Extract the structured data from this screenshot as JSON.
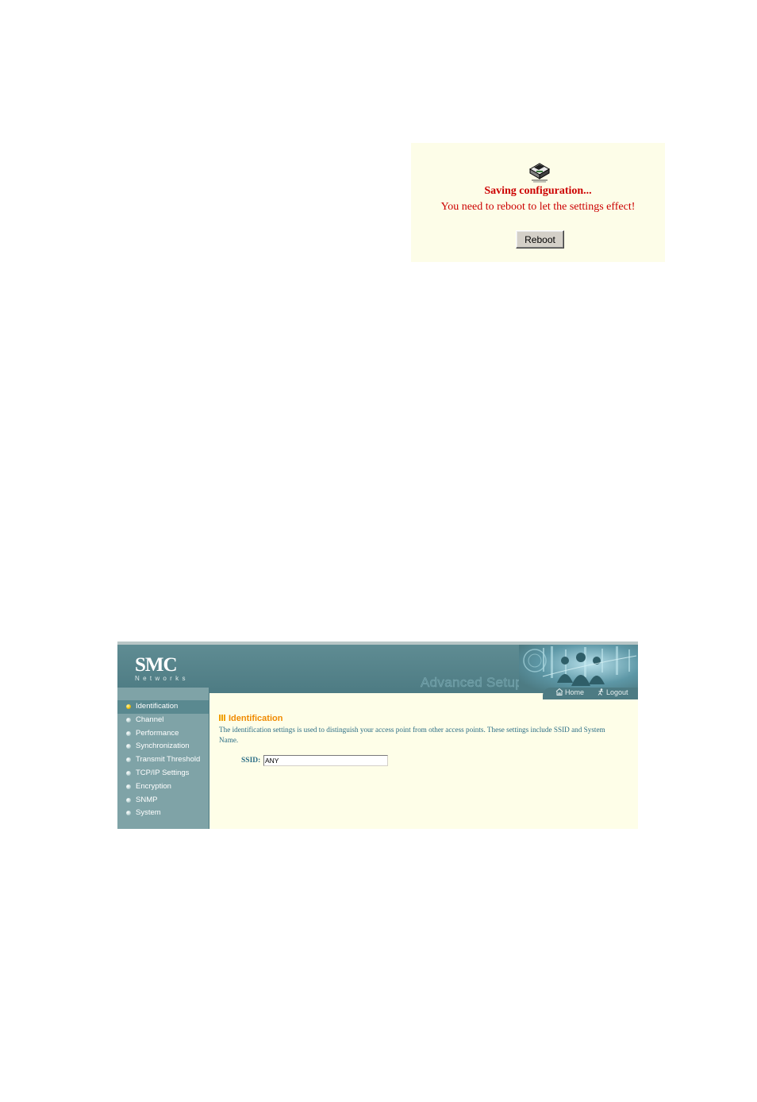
{
  "save_dialog": {
    "title": "Saving configuration...",
    "message": "You need to reboot to let the settings effect!",
    "reboot_button": "Reboot",
    "icon": "saving-disk-icon"
  },
  "smc": {
    "logo": "SMC",
    "logo_sub": "Networks",
    "header_title": "Advanced Setup",
    "tabs": {
      "home": "Home",
      "logout": "Logout"
    },
    "nav": [
      {
        "label": "Identification",
        "active": true
      },
      {
        "label": "Channel"
      },
      {
        "label": "Performance"
      },
      {
        "label": "Synchronization"
      },
      {
        "label": "Transmit Threshold"
      },
      {
        "label": "TCP/IP Settings"
      },
      {
        "label": "Encryption"
      },
      {
        "label": "SNMP"
      },
      {
        "label": "System"
      }
    ],
    "content": {
      "title": "Identification",
      "description": "The identification settings is used to distinguish your access point from other access points. These settings include SSID and System Name.",
      "ssid_label": "SSID:",
      "ssid_value": "ANY"
    }
  },
  "colors": {
    "dialog_bg": "#fdfde8",
    "dialog_text": "#cc0000",
    "header": "#5f8c93",
    "sidebar": "#7fa3a7",
    "content_bg": "#fefee8",
    "title_accent": "#f08a00",
    "text_teal": "#2c6e86"
  }
}
